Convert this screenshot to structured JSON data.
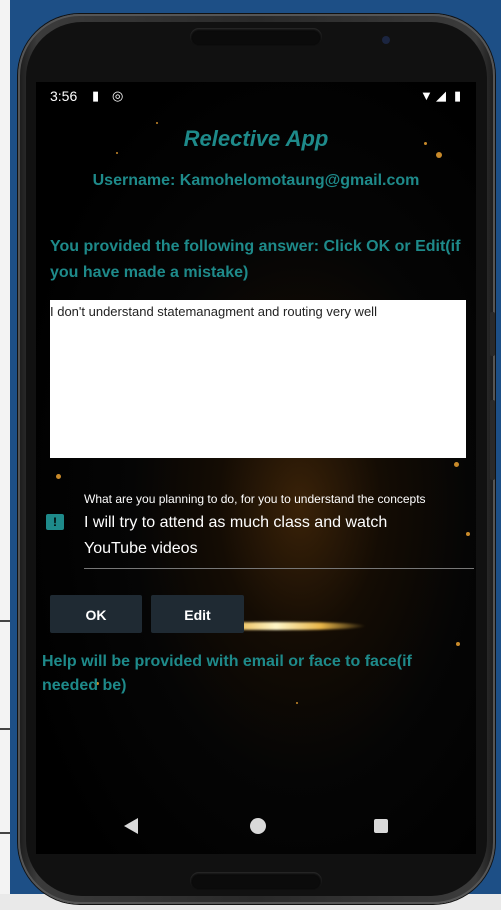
{
  "status_bar": {
    "time": "3:56",
    "left_icons": [
      "sd-card-icon",
      "sync-icon"
    ],
    "right_icons": [
      "wifi-icon",
      "signal-icon",
      "battery-icon"
    ]
  },
  "app": {
    "title": "Relective App",
    "username": "Username: Kamohelomotaung@gmail.com",
    "prompt": "You provided the following answer: Click OK or Edit(if you have made a mistake)",
    "answer": "I don't understand statemanagment and routing very well",
    "plan_field": {
      "label": "What are you planning to do, for you to understand the concepts",
      "value": "I will try to attend as much class and watch YouTube videos",
      "icon": "feedback-icon"
    },
    "buttons": {
      "ok": "OK",
      "edit": "Edit"
    },
    "help_text": "Help will be provided with email or face to face(if needed be)"
  },
  "nav_bar": {
    "icons": [
      "back-icon",
      "home-icon",
      "recents-icon"
    ]
  },
  "colors": {
    "accent": "#1e8a8a",
    "button_bg": "#1f2a33",
    "screen_bg": "#000000"
  }
}
